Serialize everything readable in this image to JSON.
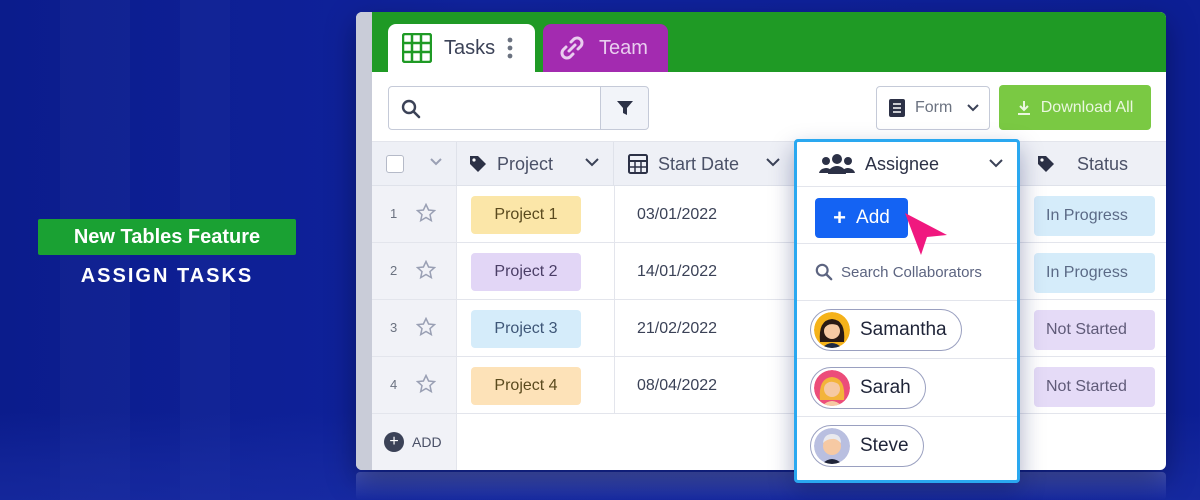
{
  "promo": {
    "badge": "New Tables Feature",
    "subtitle": "ASSIGN TASKS"
  },
  "tabs": [
    {
      "label": "Tasks",
      "icon": "table-icon"
    },
    {
      "label": "Team",
      "icon": "link-icon"
    }
  ],
  "toolbar": {
    "search_placeholder": "",
    "view_select": "Form",
    "download_label": "Download All"
  },
  "columns": {
    "project": "Project",
    "start_date": "Start Date",
    "assignee": "Assignee",
    "status": "Status"
  },
  "rows": [
    {
      "num": "1",
      "project": "Project 1",
      "start_date": "03/01/2022",
      "status": "In Progress"
    },
    {
      "num": "2",
      "project": "Project 2",
      "start_date": "14/01/2022",
      "status": "In Progress"
    },
    {
      "num": "3",
      "project": "Project 3",
      "start_date": "21/02/2022",
      "status": "Not Started"
    },
    {
      "num": "4",
      "project": "Project 4",
      "start_date": "08/04/2022",
      "status": "Not Started"
    }
  ],
  "add_row_label": "ADD",
  "assignee_panel": {
    "add_label": "Add",
    "search_placeholder": "Search Collaborators",
    "collaborators": [
      {
        "name": "Samantha"
      },
      {
        "name": "Sarah"
      },
      {
        "name": "Steve"
      }
    ]
  },
  "colors": {
    "tab_bar": "#1f9a25",
    "team_tab": "#a32bb0",
    "download": "#7ac943",
    "add_button": "#1463f3",
    "panel_border": "#2aa8f0",
    "cursor": "#f0187f",
    "in_progress": "#d5ecfa",
    "not_started": "#e5dbf7"
  }
}
